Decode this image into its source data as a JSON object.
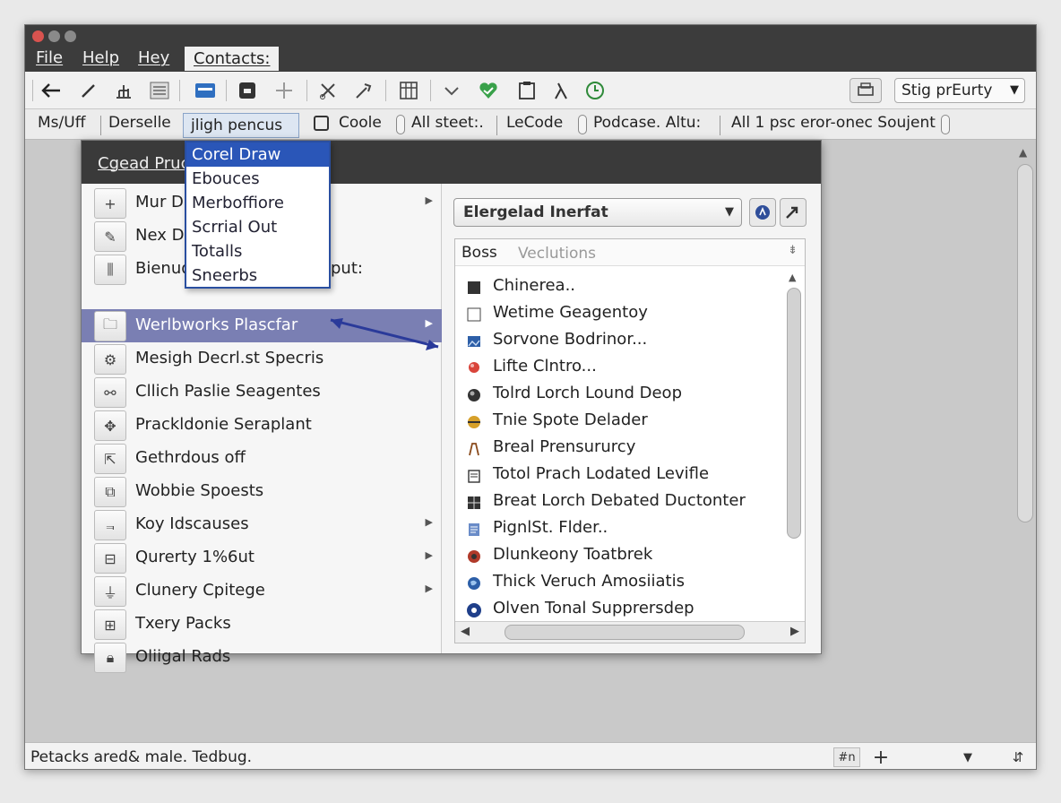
{
  "window": {
    "menus": [
      "File",
      "Help",
      "Hey"
    ],
    "active_tab": "Contacts:"
  },
  "toolbar1": {
    "combo_value": "Stig prEurty"
  },
  "toolbar2": {
    "items": [
      "Ms/Uff",
      "Derselle",
      "Coole",
      "All steet:.",
      "LeCode",
      "Podcase. Altu:",
      "All 1 psc eror-onec Soujent"
    ],
    "field_value": "jligh pencus"
  },
  "dropdown": {
    "items": [
      "Corel Draw",
      "Ebouces",
      "Merboffiore",
      "Scrrial Out",
      "Totalls",
      "Sneerbs"
    ],
    "selected_index": 0
  },
  "dialog": {
    "title": "Cgead Pruc",
    "left_items": [
      {
        "label": "Mur D",
        "icon": "plus-icon",
        "submenu": true
      },
      {
        "label": "Nex D",
        "icon": "pen-icon",
        "submenu": false
      },
      {
        "label": "Bienud",
        "icon": "equalizer-icon",
        "submenu": false
      },
      {
        "label": "Werlbworks Plascfar",
        "icon": "folder-icon",
        "submenu": true,
        "highlighted": true
      },
      {
        "label": "Mesigh Decrl.st Specris",
        "icon": "gear-icon",
        "submenu": false
      },
      {
        "label": "Cllich Paslie Seagentes",
        "icon": "network-icon",
        "submenu": false
      },
      {
        "label": "Prackldonie Seraplant",
        "icon": "puzzle-icon",
        "submenu": false
      },
      {
        "label": "Gethrdous off",
        "icon": "export-icon",
        "submenu": false
      },
      {
        "label": "Wobbie Spoests",
        "icon": "layers-icon",
        "submenu": false
      },
      {
        "label": "Koy Idscauses",
        "icon": "chart-icon",
        "submenu": true
      },
      {
        "label": "Qurerty 1%6ut",
        "icon": "lock-icon",
        "submenu": true
      },
      {
        "label": "Clunery Cpitege",
        "icon": "plug-icon",
        "submenu": true
      },
      {
        "label": "Txery Packs",
        "icon": "package-icon",
        "submenu": false
      },
      {
        "label": "Oliigal Rads",
        "icon": "padlock-icon",
        "submenu": false
      }
    ],
    "left_overlay_text": "put:",
    "right_combo": "Elergelad Inerfat",
    "right_list_headers": [
      "Boss",
      "Veclutions"
    ],
    "right_items": [
      {
        "label": "Chinerea..",
        "icon": "square-dark-icon"
      },
      {
        "label": "Wetime Geagentoy",
        "icon": "checkbox-icon"
      },
      {
        "label": "Sorvone Bodrinor...",
        "icon": "image-icon"
      },
      {
        "label": "Lifte Clntro...",
        "icon": "pin-icon"
      },
      {
        "label": "Tolrd Lorch Lound Deop",
        "icon": "globe-icon"
      },
      {
        "label": "Tnie Spote Delader",
        "icon": "smiley-icon"
      },
      {
        "label": "Breal Prensururcy",
        "icon": "arch-icon"
      },
      {
        "label": "Totol Prach Lodated Levifle",
        "icon": "clipboard-icon"
      },
      {
        "label": "Breat Lorch Debated Ductonter",
        "icon": "grid-icon"
      },
      {
        "label": "PignlSt. Flder..",
        "icon": "document-icon"
      },
      {
        "label": "Dlunkeony Toatbrek",
        "icon": "badge-icon"
      },
      {
        "label": "Thick Veruch Amosiiatis",
        "icon": "earth-icon"
      },
      {
        "label": "Olven Tonal Supprersdep",
        "icon": "disc-icon"
      }
    ]
  },
  "statusbar": {
    "text": "Petacks  ared& male. Tedbug.",
    "btn_label": "#n"
  },
  "colors": {
    "selection_blue": "#2a56b8",
    "highlight_row": "#7a7fb3",
    "arrow": "#2a3a9a"
  }
}
